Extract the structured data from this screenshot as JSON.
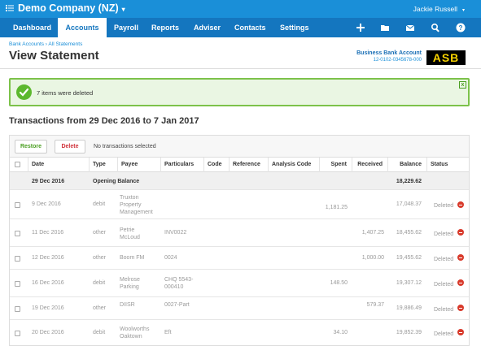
{
  "topbar": {
    "org_name": "Demo Company (NZ)",
    "org_caret": "▾",
    "user_name": "Jackie Russell",
    "user_caret": "▾"
  },
  "nav": {
    "items": [
      "Dashboard",
      "Accounts",
      "Payroll",
      "Reports",
      "Adviser",
      "Contacts",
      "Settings"
    ],
    "active": "Accounts",
    "icons": [
      "add-icon",
      "folder-icon",
      "mail-icon",
      "search-icon",
      "help-icon"
    ]
  },
  "breadcrumb": "Bank Accounts › All Statements",
  "page_title": "View Statement",
  "bank": {
    "name": "Business Bank Account",
    "number": "12-0102-0345678-000",
    "logo": "ASB"
  },
  "alert": {
    "message": "7 items were deleted",
    "close": "x"
  },
  "section_title": "Transactions from 29 Dec 2016 to 7 Jan 2017",
  "toolbar": {
    "restore_label": "Restore",
    "delete_label": "Delete",
    "info": "No transactions selected"
  },
  "columns": [
    "Date",
    "Type",
    "Payee",
    "Particulars",
    "Code",
    "Reference",
    "Analysis Code",
    "Spent",
    "Received",
    "Balance",
    "Status"
  ],
  "opening": {
    "date": "29 Dec 2016",
    "label": "Opening Balance",
    "balance": "18,229.62"
  },
  "rows": [
    {
      "date": "9 Dec 2016",
      "type": "debit",
      "payee": "Truxton Property Management",
      "particulars": "",
      "spent": "1,181.25",
      "received": "",
      "balance": "17,048.37",
      "status": "Deleted"
    },
    {
      "date": "11 Dec 2016",
      "type": "other",
      "payee": "Petrie McLoud",
      "particulars": "INV0022",
      "spent": "",
      "received": "1,407.25",
      "balance": "18,455.62",
      "status": "Deleted"
    },
    {
      "date": "12 Dec 2016",
      "type": "other",
      "payee": "Boom FM",
      "particulars": "0024",
      "spent": "",
      "received": "1,000.00",
      "balance": "19,455.62",
      "status": "Deleted"
    },
    {
      "date": "16 Dec 2016",
      "type": "debit",
      "payee": "Melrose Parking",
      "particulars": "CHQ 5543-000410",
      "spent": "148.50",
      "received": "",
      "balance": "19,307.12",
      "status": "Deleted"
    },
    {
      "date": "19 Dec 2016",
      "type": "other",
      "payee": "DIISR",
      "particulars": "0027-Part",
      "spent": "",
      "received": "579.37",
      "balance": "19,886.49",
      "status": "Deleted"
    },
    {
      "date": "20 Dec 2016",
      "type": "debit",
      "payee": "Woolworths Oaktown",
      "particulars": "Eft",
      "spent": "34.10",
      "received": "",
      "balance": "19,852.39",
      "status": "Deleted"
    }
  ],
  "colors": {
    "topbar": "#1a8fd8",
    "navbar": "#1476bf",
    "success": "#5cb82e",
    "danger": "#d83a2b"
  }
}
